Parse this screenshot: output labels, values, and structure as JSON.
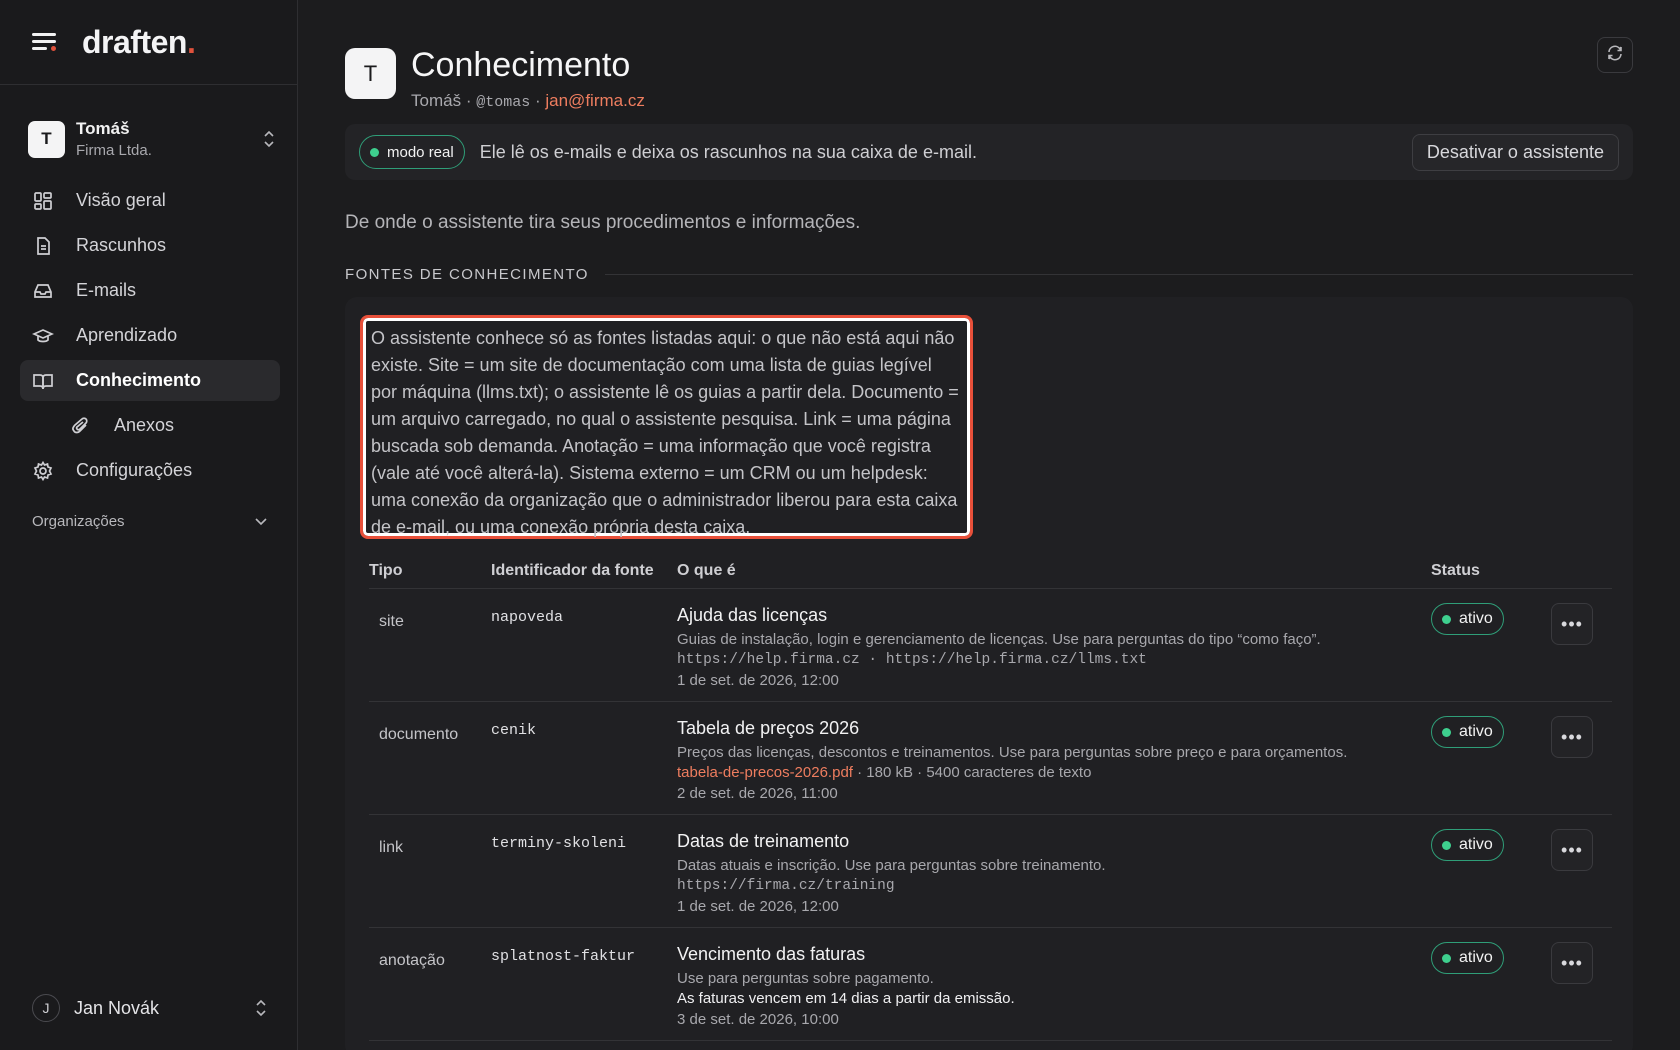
{
  "brand": {
    "name": "draften",
    "dot": "."
  },
  "account": {
    "initial": "T",
    "name": "Tomáš",
    "org": "Firma Ltda."
  },
  "nav": {
    "items": [
      {
        "label": "Visão geral"
      },
      {
        "label": "Rascunhos"
      },
      {
        "label": "E-mails"
      },
      {
        "label": "Aprendizado"
      },
      {
        "label": "Conhecimento"
      },
      {
        "label": "Anexos"
      },
      {
        "label": "Configurações"
      }
    ],
    "organizations_label": "Organizações"
  },
  "user": {
    "initial": "J",
    "name": "Jan Novák"
  },
  "page": {
    "initial": "T",
    "title": "Conhecimento",
    "owner": "Tomáš",
    "sep": "·",
    "handle": "@tomas",
    "email": "jan@firma.cz"
  },
  "mode": {
    "badge": "modo real",
    "text": "Ele lê os e-mails e deixa os rascunhos na sua caixa de e-mail.",
    "deactivate_label": "Desativar o assistente"
  },
  "intro": "De onde o assistente tira seus procedimentos e informações.",
  "section_label": "FONTES DE CONHECIMENTO",
  "note": "O assistente conhece só as fontes listadas aqui: o que não está aqui não existe. Site = um site de documentação com uma lista de guias legível por máquina (llms.txt); o assistente lê os guias a partir dela. Documento = um arquivo carregado, no qual o assistente pesquisa. Link = uma página buscada sob demanda. Anotação = uma informação que você registra (vale até você alterá-la). Sistema externo = um CRM ou um helpdesk: uma conexão da organização que o administrador liberou para esta caixa de e-mail, ou uma conexão própria desta caixa.",
  "table": {
    "headers": {
      "type": "Tipo",
      "id": "Identificador da fonte",
      "what": "O que é",
      "status": "Status"
    },
    "rows": [
      {
        "type": "site",
        "id": "napoveda",
        "title": "Ajuda das licenças",
        "desc": "Guias de instalação, login e gerenciamento de licenças. Use para perguntas do tipo “como faço”.",
        "meta": "https://help.firma.cz · https://help.firma.cz/llms.txt",
        "date": "1 de set. de 2026, 12:00",
        "status": "ativo"
      },
      {
        "type": "documento",
        "id": "cenik",
        "title": "Tabela de preços 2026",
        "desc": "Preços das licenças, descontos e treinamentos. Use para perguntas sobre preço e para orçamentos.",
        "file": "tabela-de-precos-2026.pdf",
        "file_info": " · 180 kB · 5400 caracteres de texto",
        "date": "2 de set. de 2026, 11:00",
        "status": "ativo"
      },
      {
        "type": "link",
        "id": "terminy-skoleni",
        "title": "Datas de treinamento",
        "desc": "Datas atuais e inscrição. Use para perguntas sobre treinamento.",
        "meta": "https://firma.cz/training",
        "date": "1 de set. de 2026, 12:00",
        "status": "ativo"
      },
      {
        "type": "anotação",
        "id": "splatnost-faktur",
        "title": "Vencimento das faturas",
        "desc": "Use para perguntas sobre pagamento.",
        "note": "As faturas vencem em 14 dias a partir da emissão.",
        "date": "3 de set. de 2026, 10:00",
        "status": "ativo"
      }
    ]
  },
  "colors": {
    "accent": "#e0523c",
    "link": "#ee7d5f",
    "status": "#3ecf8e",
    "highlight": "#e8503a"
  }
}
